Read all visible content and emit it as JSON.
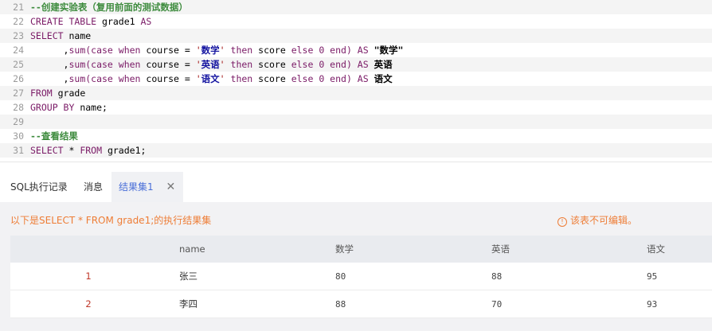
{
  "editor": {
    "lines": [
      {
        "num": "21",
        "tokens": [
          {
            "t": "--创建实验表（复用前面的测试数据）",
            "c": "cm"
          }
        ]
      },
      {
        "num": "22",
        "tokens": [
          {
            "t": "CREATE TABLE",
            "c": "kw"
          },
          {
            "t": " grade1 ",
            "c": "plain"
          },
          {
            "t": "AS",
            "c": "kw"
          }
        ]
      },
      {
        "num": "23",
        "tokens": [
          {
            "t": "SELECT",
            "c": "kw"
          },
          {
            "t": " name",
            "c": "plain"
          }
        ]
      },
      {
        "num": "24",
        "tokens": [
          {
            "t": "      ,",
            "c": "plain"
          },
          {
            "t": "sum(case when",
            "c": "kw"
          },
          {
            "t": " course ",
            "c": "plain"
          },
          {
            "t": "=",
            "c": "plain"
          },
          {
            "t": " '",
            "c": "str"
          },
          {
            "t": "数学",
            "c": "cn"
          },
          {
            "t": "' ",
            "c": "str"
          },
          {
            "t": "then",
            "c": "kw"
          },
          {
            "t": " score ",
            "c": "plain"
          },
          {
            "t": "else 0 end)",
            "c": "num"
          },
          {
            "t": " AS ",
            "c": "kw"
          },
          {
            "t": "\"数学\"",
            "c": "ids"
          }
        ]
      },
      {
        "num": "25",
        "tokens": [
          {
            "t": "      ,",
            "c": "plain"
          },
          {
            "t": "sum(case when",
            "c": "kw"
          },
          {
            "t": " course ",
            "c": "plain"
          },
          {
            "t": "=",
            "c": "plain"
          },
          {
            "t": " '",
            "c": "str"
          },
          {
            "t": "英语",
            "c": "cn"
          },
          {
            "t": "' ",
            "c": "str"
          },
          {
            "t": "then",
            "c": "kw"
          },
          {
            "t": " score ",
            "c": "plain"
          },
          {
            "t": "else 0 end)",
            "c": "num"
          },
          {
            "t": " AS ",
            "c": "kw"
          },
          {
            "t": "英语",
            "c": "ids"
          }
        ]
      },
      {
        "num": "26",
        "tokens": [
          {
            "t": "      ,",
            "c": "plain"
          },
          {
            "t": "sum(case when",
            "c": "kw"
          },
          {
            "t": " course ",
            "c": "plain"
          },
          {
            "t": "=",
            "c": "plain"
          },
          {
            "t": " '",
            "c": "str"
          },
          {
            "t": "语文",
            "c": "cn"
          },
          {
            "t": "' ",
            "c": "str"
          },
          {
            "t": "then",
            "c": "kw"
          },
          {
            "t": " score ",
            "c": "plain"
          },
          {
            "t": "else 0 end)",
            "c": "num"
          },
          {
            "t": " AS ",
            "c": "kw"
          },
          {
            "t": "语文",
            "c": "ids"
          }
        ]
      },
      {
        "num": "27",
        "tokens": [
          {
            "t": "FROM",
            "c": "kw"
          },
          {
            "t": " grade",
            "c": "plain"
          }
        ]
      },
      {
        "num": "28",
        "tokens": [
          {
            "t": "GROUP BY",
            "c": "kw"
          },
          {
            "t": " name;",
            "c": "plain"
          }
        ]
      },
      {
        "num": "29",
        "tokens": []
      },
      {
        "num": "30",
        "tokens": [
          {
            "t": "--查看结果",
            "c": "cm"
          }
        ]
      },
      {
        "num": "31",
        "tokens": [
          {
            "t": "SELECT",
            "c": "kw"
          },
          {
            "t": " * ",
            "c": "plain"
          },
          {
            "t": "FROM",
            "c": "kw"
          },
          {
            "t": " grade1;",
            "c": "plain"
          }
        ]
      }
    ]
  },
  "tabs": {
    "history": "SQL执行记录",
    "messages": "消息",
    "result": "结果集1",
    "close": "✕"
  },
  "result": {
    "info": "以下是SELECT * FROM grade1;的执行结果集",
    "readonly_icon": "!",
    "readonly": "该表不可编辑。",
    "columns": [
      "",
      "name",
      "数学",
      "英语",
      "语文"
    ],
    "rows": [
      [
        "1",
        "张三",
        "80",
        "88",
        "95"
      ],
      [
        "2",
        "李四",
        "88",
        "70",
        "93"
      ]
    ]
  },
  "colors": {
    "accent": "#4a6fd8",
    "warning": "#ee7d36",
    "keyword": "#7a1a66",
    "comment": "#3d8b3d"
  }
}
